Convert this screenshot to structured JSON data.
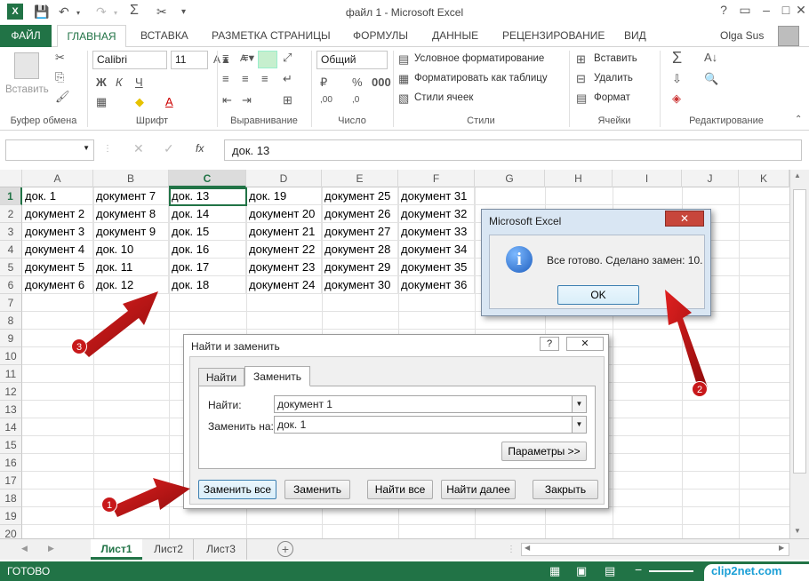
{
  "window": {
    "title": "файл 1 - Microsoft Excel"
  },
  "ribbon_tabs": [
    "ФАЙЛ",
    "ГЛАВНАЯ",
    "ВСТАВКА",
    "РАЗМЕТКА СТРАНИЦЫ",
    "ФОРМУЛЫ",
    "ДАННЫЕ",
    "РЕЦЕНЗИРОВАНИЕ",
    "ВИД"
  ],
  "user": "Olga Sus",
  "ribbon": {
    "paste": "Вставить",
    "font_name": "Calibri",
    "font_size": "11",
    "number_format": "Общий",
    "cond_format": "Условное форматирование",
    "format_table": "Форматировать как таблицу",
    "cell_styles": "Стили ячеек",
    "insert": "Вставить",
    "delete": "Удалить",
    "format": "Формат",
    "groups": [
      "Буфер обмена",
      "Шрифт",
      "Выравнивание",
      "Число",
      "Стили",
      "Ячейки",
      "Редактирование"
    ]
  },
  "formula_bar": {
    "fx": "fx",
    "value": "док. 13"
  },
  "columns": [
    "A",
    "B",
    "C",
    "D",
    "E",
    "F",
    "G",
    "H",
    "I",
    "J",
    "K"
  ],
  "rows": [
    "1",
    "2",
    "3",
    "4",
    "5",
    "6",
    "7",
    "8",
    "9",
    "10",
    "11",
    "12",
    "13",
    "14",
    "15",
    "16",
    "17",
    "18",
    "19",
    "20"
  ],
  "cells": [
    [
      "док. 1",
      "документ 7",
      "док. 13",
      "док. 19",
      "документ 25",
      "документ 31"
    ],
    [
      "документ 2",
      "документ 8",
      "док. 14",
      "документ 20",
      "документ 26",
      "документ 32"
    ],
    [
      "документ 3",
      "документ 9",
      "док. 15",
      "документ 21",
      "документ 27",
      "документ 33"
    ],
    [
      "документ 4",
      "док. 10",
      "док. 16",
      "документ 22",
      "документ 28",
      "документ 34"
    ],
    [
      "документ 5",
      "док. 11",
      "док. 17",
      "документ 23",
      "документ 29",
      "документ 35"
    ],
    [
      "документ 6",
      "док. 12",
      "док. 18",
      "документ 24",
      "документ 30",
      "документ 36"
    ]
  ],
  "sheets": [
    "Лист1",
    "Лист2",
    "Лист3"
  ],
  "status": "ГОТОВО",
  "watermark": "clip2net.com",
  "msgbox": {
    "title": "Microsoft Excel",
    "text": "Все готово. Сделано замен: 10.",
    "ok": "OK"
  },
  "find_replace": {
    "title": "Найти и заменить",
    "tab_find": "Найти",
    "tab_replace": "Заменить",
    "find_label": "Найти:",
    "find_value": "документ 1",
    "replace_label": "Заменить на:",
    "replace_value": "док. 1",
    "params": "Параметры >>",
    "replace_all": "Заменить все",
    "replace": "Заменить",
    "find_all": "Найти все",
    "find_next": "Найти далее",
    "close": "Закрыть"
  },
  "badges": [
    "1",
    "2",
    "3"
  ]
}
